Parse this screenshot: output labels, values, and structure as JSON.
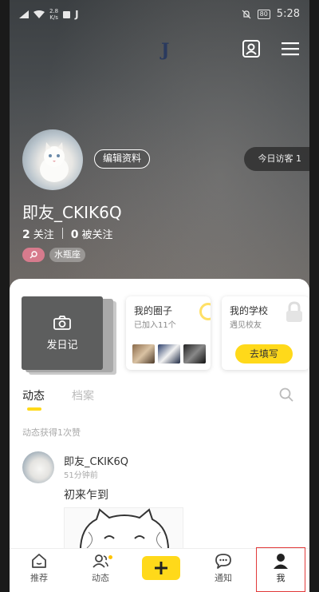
{
  "status_bar": {
    "net_speed_value": "2.8",
    "net_speed_unit": "K/s",
    "app_icon_letter": "J",
    "battery": "80",
    "time": "5:28"
  },
  "header": {
    "logo": "J",
    "icons": [
      "contact-card-icon",
      "menu-icon"
    ]
  },
  "profile": {
    "edit_label": "编辑资料",
    "visitors_label": "今日访客 1",
    "username": "即友_CKIK6Q",
    "following_count": "2",
    "following_label": "关注",
    "followers_count": "0",
    "followers_label": "被关注",
    "zodiac": "水瓶座"
  },
  "cards": {
    "diary_label": "发日记",
    "circle_title": "我的圈子",
    "circle_sub": "已加入11个",
    "school_title": "我的学校",
    "school_sub": "遇见校友",
    "school_button": "去填写"
  },
  "tabs": [
    {
      "label": "动态",
      "active": true
    },
    {
      "label": "档案",
      "active": false
    }
  ],
  "feed": {
    "likes_text": "动态获得1次赞",
    "post": {
      "user": "即友_CKIK6Q",
      "time": "51分钟前",
      "text": "初来乍到"
    }
  },
  "bottom_nav": [
    {
      "label": "推荐",
      "icon": "home-icon"
    },
    {
      "label": "动态",
      "icon": "people-icon"
    },
    {
      "label": "",
      "icon": "plus-icon"
    },
    {
      "label": "通知",
      "icon": "chat-bubble-icon"
    },
    {
      "label": "我",
      "icon": "person-icon"
    }
  ],
  "colors": {
    "accent": "#ffd91a",
    "highlight_box": "#e23a3a",
    "gender_tag": "#d77b8d"
  }
}
